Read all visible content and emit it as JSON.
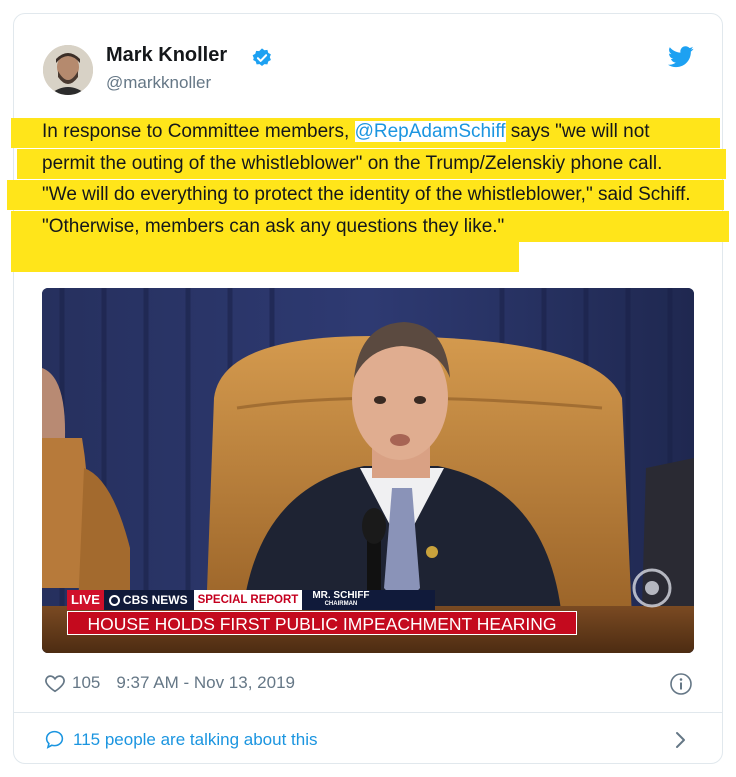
{
  "author": {
    "name": "Mark Knoller",
    "handle": "@markknoller",
    "verified": true
  },
  "tweet": {
    "text_before": "In response to Committee members, ",
    "mention": "@RepAdamSchiff",
    "text_after": " says \"we will not permit the outing of the whistleblower\" on the Trump/Zelenskiy phone call. \"We will do everything to protect the identity of the whistleblower,\" said Schiff. \"Otherwise, members can ask any questions they like.\""
  },
  "media": {
    "live": "LIVE",
    "network": "CBS NEWS",
    "special": "SPECIAL REPORT",
    "name_tag": "MR. SCHIFF",
    "name_sub": "CHAIRMAN",
    "headline": "HOUSE HOLDS FIRST PUBLIC IMPEACHMENT HEARING"
  },
  "footer": {
    "likes": "105",
    "timestamp": "9:37 AM - Nov 13, 2019",
    "talking": "115 people are talking about this"
  },
  "colors": {
    "highlight": "#ffe51a",
    "link": "#1b95e0",
    "muted": "#657786"
  },
  "icons": [
    "verified-badge-icon",
    "twitter-bird-icon",
    "heart-icon",
    "info-icon",
    "speech-bubble-icon",
    "chevron-right-icon"
  ]
}
